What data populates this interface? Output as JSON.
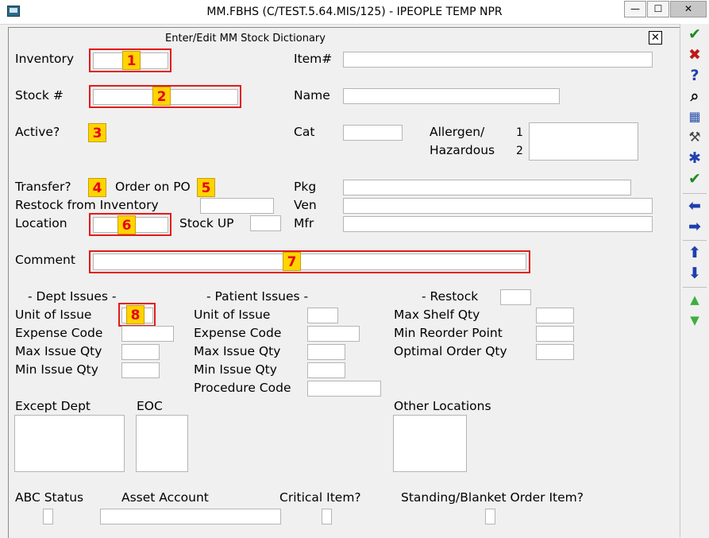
{
  "window": {
    "title": "MM.FBHS (C/TEST.5.64.MIS/125) - IPEOPLE TEMP NPR",
    "minimize": "—",
    "maximize": "☐",
    "close": "✕"
  },
  "form": {
    "subtitle": "Enter/Edit MM Stock Dictionary",
    "close": "✕"
  },
  "labels": {
    "inventory": "Inventory",
    "stock": "Stock #",
    "active": "Active?",
    "transfer": "Transfer?",
    "order_on_po": "Order on PO",
    "restock_from_inventory": "Restock from Inventory",
    "location": "Location",
    "stock_up": "Stock UP",
    "comment": "Comment",
    "item": "Item#",
    "name": "Name",
    "cat": "Cat",
    "allergen": "Allergen/",
    "hazardous": "Hazardous",
    "allergen_1": "1",
    "allergen_2": "2",
    "pkg": "Pkg",
    "ven": "Ven",
    "mfr": "Mfr",
    "dept_issues": "- Dept Issues -",
    "patient_issues": "- Patient Issues -",
    "restock": "- Restock",
    "unit_of_issue": "Unit of Issue",
    "expense_code": "Expense Code",
    "max_issue_qty": "Max Issue Qty",
    "min_issue_qty": "Min Issue Qty",
    "procedure_code": "Procedure Code",
    "max_shelf_qty": "Max Shelf Qty",
    "min_reorder_point": "Min Reorder Point",
    "optimal_order_qty": "Optimal Order Qty",
    "except_dept": "Except Dept",
    "eoc": "EOC",
    "other_locations": "Other Locations",
    "abc_status": "ABC Status",
    "asset_account": "Asset Account",
    "critical_item": "Critical Item?",
    "standing_blanket": "Standing/Blanket Order Item?"
  },
  "badges": [
    "1",
    "2",
    "3",
    "4",
    "5",
    "6",
    "7",
    "8"
  ],
  "toolbar": {
    "ok": "✔",
    "cancel": "✖",
    "help": "?",
    "find": "⌕",
    "grid": "▦",
    "tools": "⚒",
    "star": "✱",
    "all": "✔",
    "prev": "⬅",
    "next": "➡",
    "up": "⬆",
    "down": "⬇",
    "scroll_up": "▲",
    "scroll_down": "▼"
  },
  "colors": {
    "highlight": "#e21b1b",
    "badge_bg": "#ffd400",
    "badge_text": "#e8001c",
    "ok": "#1f8a1f",
    "cancel": "#c01818",
    "nav": "#1f3fae",
    "scroll": "#3fae3f"
  }
}
